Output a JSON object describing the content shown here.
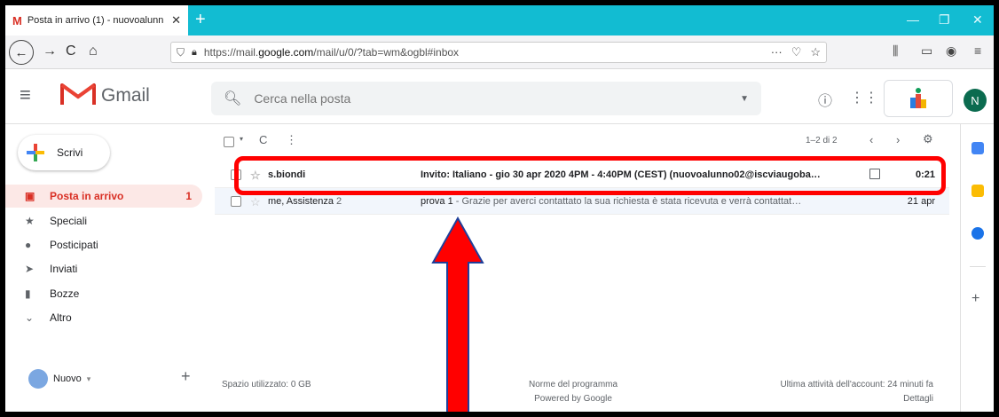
{
  "browser": {
    "tab_title": "Posta in arrivo (1) - nuovoalunn",
    "url_prefix": "https://mail.",
    "url_domain": "google.com",
    "url_suffix": "/mail/u/0/?tab=wm&ogbl#inbox",
    "url_actions": "···"
  },
  "gmail": {
    "app_name": "Gmail",
    "search_placeholder": "Cerca nella posta",
    "avatar_letter": "N",
    "compose_label": "Scrivi"
  },
  "sidebar": {
    "items": [
      {
        "label": "Posta in arrivo",
        "count": "1",
        "icon": "inbox-icon"
      },
      {
        "label": "Speciali",
        "count": "",
        "icon": "star-icon"
      },
      {
        "label": "Posticipati",
        "count": "",
        "icon": "clock-icon"
      },
      {
        "label": "Inviati",
        "count": "",
        "icon": "send-icon"
      },
      {
        "label": "Bozze",
        "count": "",
        "icon": "draft-icon"
      },
      {
        "label": "Altro",
        "count": "",
        "icon": "chevron-down-icon"
      }
    ],
    "hangouts_user": "Nuovo"
  },
  "toolbar": {
    "pagination": "1–2 di 2"
  },
  "emails": [
    {
      "sender": "s.biondi",
      "subject": "Invito: Italiano - gio 30 apr 2020 4PM - 4:40PM (CEST) (nuovoalunno02@iscviaugoba…",
      "date": "0:21",
      "unread": true
    },
    {
      "sender": "me, Assistenza",
      "count": "2",
      "subject_bold": "prova 1",
      "snippet": " - Grazie per averci contattato la sua richiesta è stata ricevuta e verrà contattat…",
      "date": "21 apr",
      "unread": false
    }
  ],
  "footer": {
    "storage": "Spazio utilizzato: 0 GB",
    "policies": "Norme del programma",
    "powered": "Powered by Google",
    "last_activity": "Ultima attività dell'account: 24 minuti fa",
    "details": "Dettagli"
  },
  "colors": {
    "tabbar": "#12bcd2",
    "gmail_red": "#d93025",
    "annotation_red": "#ff0000",
    "arrow_blue": "#1f3f9a"
  }
}
